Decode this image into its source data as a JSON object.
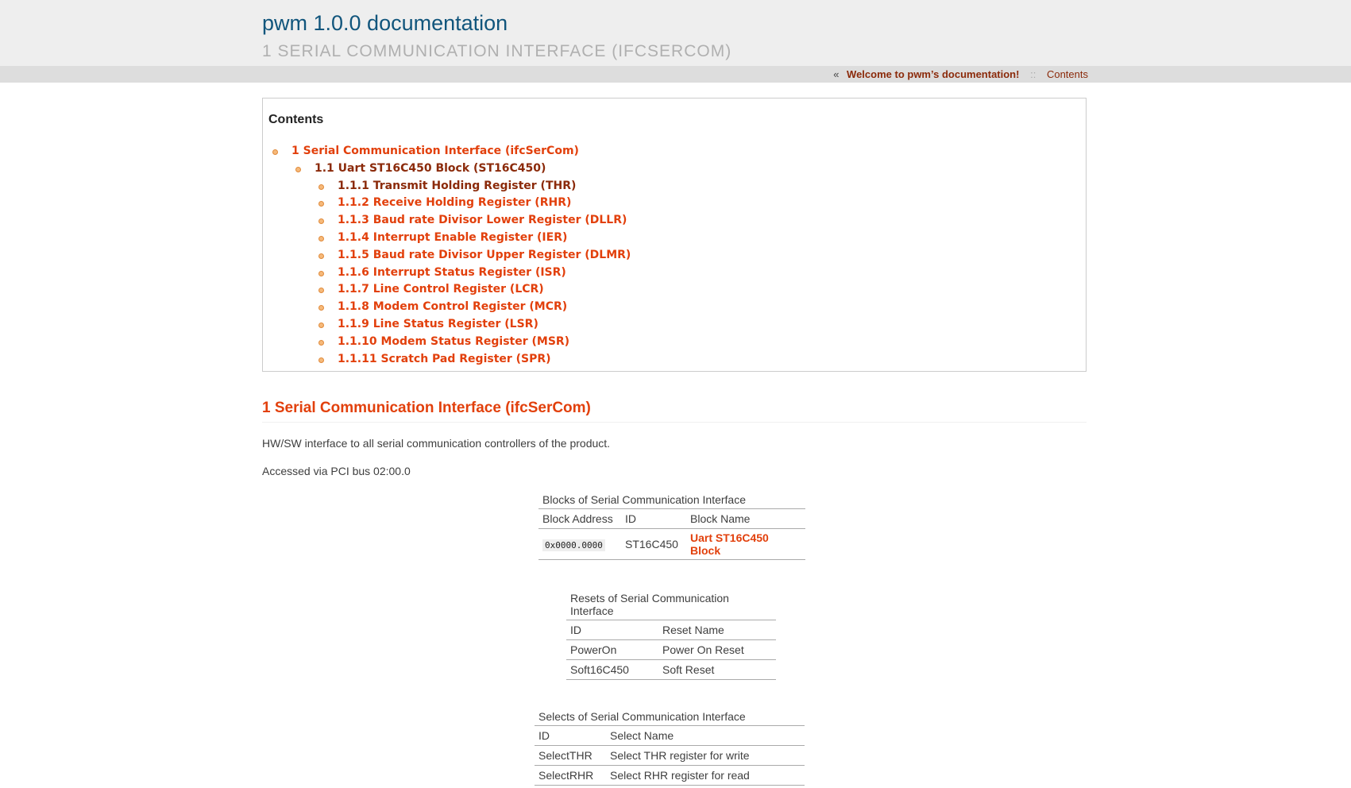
{
  "header": {
    "title": "pwm 1.0.0 documentation",
    "subtitle": "1 SERIAL COMMUNICATION INTERFACE (IFCSERCOM)"
  },
  "topnav": {
    "laquo": "«",
    "home_link": "Welcome to pwm’s documentation!",
    "separator": "::",
    "contents_link": "Contents"
  },
  "toc": {
    "title": "Contents",
    "items": [
      {
        "label": "1 Serial Communication Interface (ifcSerCom)",
        "level": 1,
        "current": false
      },
      {
        "label": "1.1 Uart ST16C450 Block (ST16C450)",
        "level": 2,
        "current": true
      },
      {
        "label": "1.1.1 Transmit Holding Register (THR)",
        "level": 3,
        "current": true
      },
      {
        "label": "1.1.2 Receive Holding Register (RHR)",
        "level": 3,
        "current": false
      },
      {
        "label": "1.1.3 Baud rate Divisor Lower Register (DLLR)",
        "level": 3,
        "current": false
      },
      {
        "label": "1.1.4 Interrupt Enable Register (IER)",
        "level": 3,
        "current": false
      },
      {
        "label": "1.1.5 Baud rate Divisor Upper Register (DLMR)",
        "level": 3,
        "current": false
      },
      {
        "label": "1.1.6 Interrupt Status Register (ISR)",
        "level": 3,
        "current": false
      },
      {
        "label": "1.1.7 Line Control Register (LCR)",
        "level": 3,
        "current": false
      },
      {
        "label": "1.1.8 Modem Control Register (MCR)",
        "level": 3,
        "current": false
      },
      {
        "label": "1.1.9 Line Status Register (LSR)",
        "level": 3,
        "current": false
      },
      {
        "label": "1.1.10 Modem Status Register (MSR)",
        "level": 3,
        "current": false
      },
      {
        "label": "1.1.11 Scratch Pad Register (SPR)",
        "level": 3,
        "current": false
      }
    ]
  },
  "section": {
    "heading": "1 Serial Communication Interface (ifcSerCom)",
    "para1": "HW/SW interface to all serial communication controllers of the product.",
    "para2": "Accessed via PCI bus 02:00.0"
  },
  "blocks_table": {
    "caption": "Blocks of Serial Communication Interface",
    "headers": [
      "Block Address",
      "ID",
      "Block Name"
    ],
    "rows": [
      {
        "address": "0x0000.0000",
        "id": "ST16C450",
        "name": "Uart ST16C450 Block"
      }
    ]
  },
  "resets_table": {
    "caption": "Resets of Serial Communication Interface",
    "headers": [
      "ID",
      "Reset Name"
    ],
    "rows": [
      [
        "PowerOn",
        "Power On Reset"
      ],
      [
        "Soft16C450",
        "Soft Reset"
      ]
    ]
  },
  "selects_table": {
    "caption": "Selects of Serial Communication Interface",
    "headers": [
      "ID",
      "Select Name"
    ],
    "rows": [
      [
        "SelectTHR",
        "Select THR register for write"
      ],
      [
        "SelectRHR",
        "Select RHR register for read"
      ]
    ]
  },
  "colors": {
    "link": "#e2400c",
    "visited_link": "#8b2a0a",
    "header_title": "#11557c",
    "header_bg": "#eeeeee",
    "nav_bg": "#dddddd",
    "bullet": "#f6b97a"
  }
}
